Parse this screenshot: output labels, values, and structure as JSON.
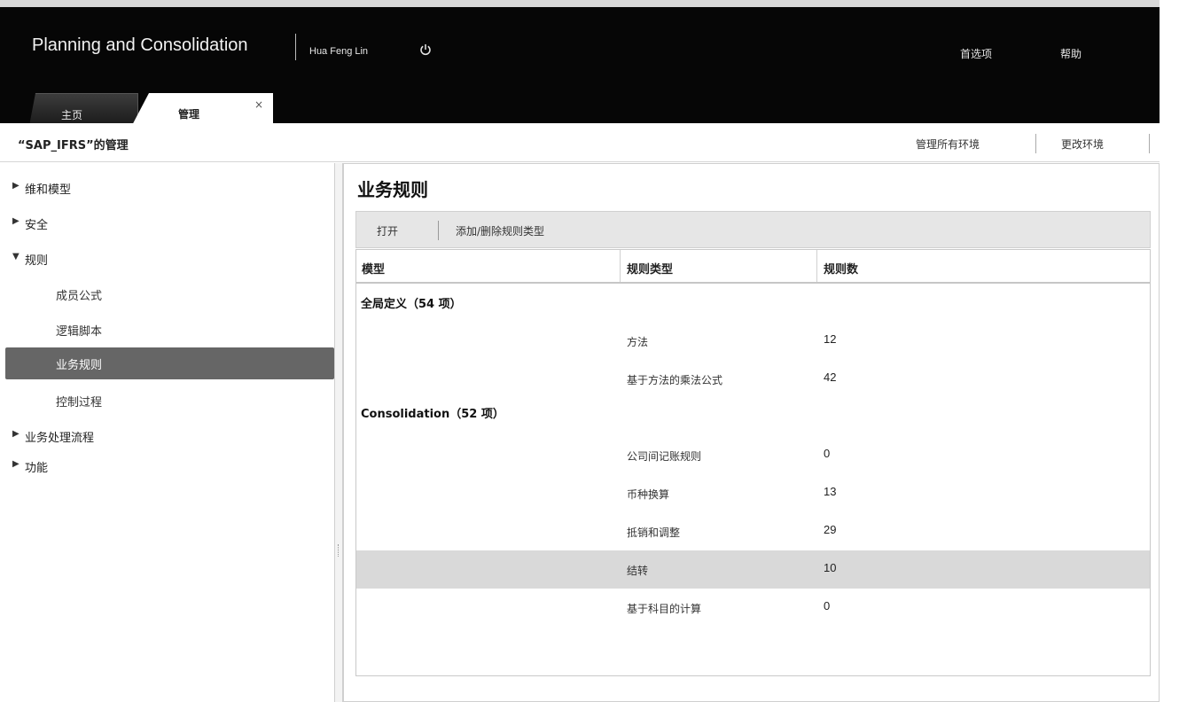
{
  "header": {
    "app_title": "Planning and Consolidation",
    "user_name": "Hua Feng Lin",
    "links": [
      "首选项",
      "帮助"
    ],
    "tabs": [
      {
        "label": "主页"
      },
      {
        "label": "管理",
        "close": "×"
      }
    ]
  },
  "titlebar": {
    "page_title": "“SAP_IFRS”的管理",
    "links": [
      "管理所有环境",
      "更改环境"
    ]
  },
  "nav": {
    "items": [
      {
        "label": "维和模型",
        "arrow": "▶"
      },
      {
        "label": "安全",
        "arrow": "▶"
      },
      {
        "label": "规则",
        "arrow": "▼"
      },
      {
        "label": "成员公式"
      },
      {
        "label": "逻辑脚本"
      },
      {
        "label": "业务规则"
      },
      {
        "label": "控制过程"
      },
      {
        "label": "业务处理流程",
        "arrow": "▶"
      },
      {
        "label": "功能",
        "arrow": "▶"
      }
    ],
    "selected": "业务规则"
  },
  "content": {
    "title": "业务规则",
    "toolbar": {
      "open": "打开",
      "add_remove": "添加/删除规则类型"
    },
    "columns": [
      "模型",
      "规则类型",
      "规则数"
    ],
    "groups": [
      {
        "name": "全局定义（54 项）",
        "rows": [
          {
            "type": "方法",
            "count": "12"
          },
          {
            "type": "基于方法的乘法公式",
            "count": "42"
          }
        ]
      },
      {
        "name": "Consolidation（52 项）",
        "rows": [
          {
            "type": "公司间记账规则",
            "count": "0"
          },
          {
            "type": "币种换算",
            "count": "13"
          },
          {
            "type": "抵销和调整",
            "count": "29"
          },
          {
            "type": "结转",
            "count": "10",
            "highlighted": true
          },
          {
            "type": "基于科目的计算",
            "count": "0"
          }
        ]
      }
    ]
  },
  "colors": {
    "header_bg": "#060606",
    "selected_bg": "#666666",
    "highlight_row": "#d9d9d9"
  }
}
